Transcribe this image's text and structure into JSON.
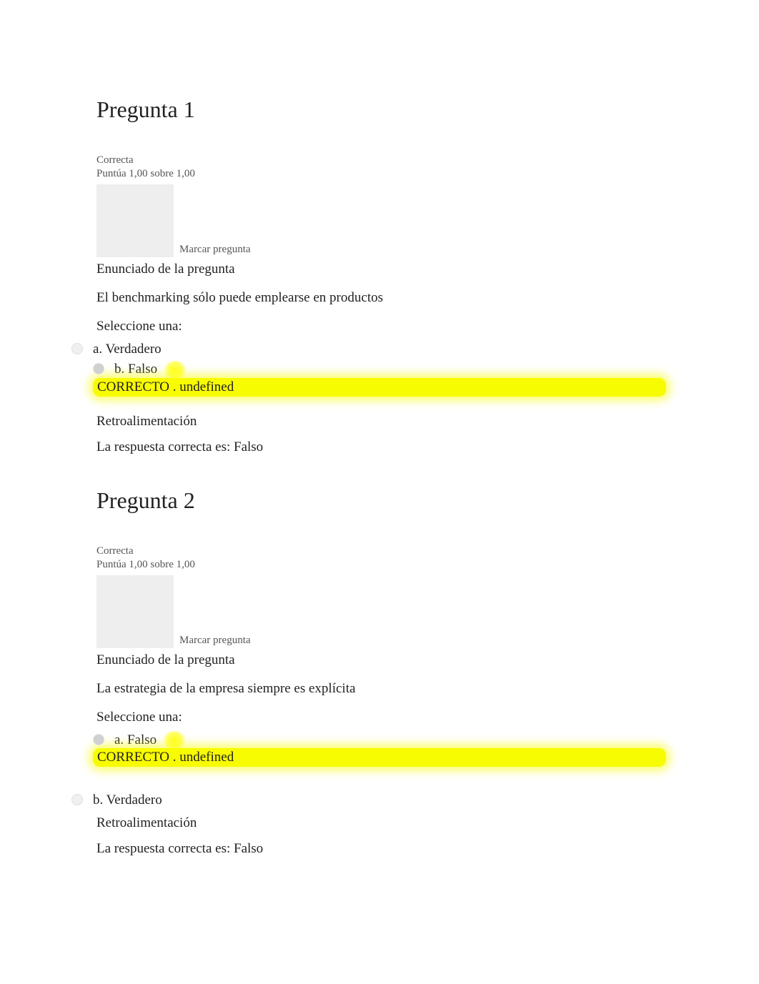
{
  "questions": [
    {
      "title": "Pregunta 1",
      "status": "Correcta",
      "score": "Puntúa 1,00 sobre 1,00",
      "flag_label": "Marcar pregunta",
      "statement_header": "Enunciado de la pregunta",
      "question_text": "El benchmarking sólo puede emplearse en productos",
      "select_prompt": "Seleccione una:",
      "options": [
        {
          "letter": "a.",
          "label": "Verdadero",
          "selected": false,
          "correct_badge": false
        },
        {
          "letter": "b.",
          "label": "Falso",
          "selected": true,
          "correct_badge": true
        }
      ],
      "correct_bar": "CORRECTO . undefined",
      "feedback_header": "Retroalimentación",
      "feedback_text": "La respuesta correcta es: Falso"
    },
    {
      "title": "Pregunta 2",
      "status": "Correcta",
      "score": "Puntúa 1,00 sobre 1,00",
      "flag_label": "Marcar pregunta",
      "statement_header": "Enunciado de la pregunta",
      "question_text": "La estrategia de la empresa siempre es explícita",
      "select_prompt": "Seleccione una:",
      "options": [
        {
          "letter": "a.",
          "label": "Falso",
          "selected": true,
          "correct_badge": true
        },
        {
          "letter": "b.",
          "label": "Verdadero",
          "selected": false,
          "correct_badge": false
        }
      ],
      "correct_bar": "CORRECTO . undefined",
      "feedback_header": "Retroalimentación",
      "feedback_text": "La respuesta correcta es: Falso"
    }
  ]
}
